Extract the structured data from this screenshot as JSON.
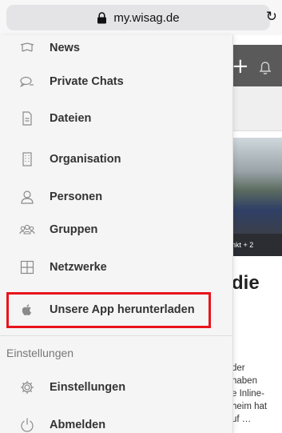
{
  "browser": {
    "url": "my.wisag.de",
    "lock_icon": "lock-icon",
    "reload_icon": "reload-icon"
  },
  "menu": {
    "items": [
      {
        "label": "News",
        "icon": "news-icon"
      },
      {
        "label": "Private Chats",
        "icon": "chat-bubbles-icon"
      },
      {
        "label": "Dateien",
        "icon": "file-icon"
      },
      {
        "label": "Organisation",
        "icon": "building-icon"
      },
      {
        "label": "Personen",
        "icon": "person-icon"
      },
      {
        "label": "Gruppen",
        "icon": "group-icon"
      },
      {
        "label": "Netzwerke",
        "icon": "grid-icon"
      },
      {
        "label": "Unsere App herunterladen",
        "icon": "apple-icon"
      }
    ],
    "section_title": "Einstellungen",
    "settings_items": [
      {
        "label": "Einstellungen",
        "icon": "gear-icon"
      },
      {
        "label": "Abmelden",
        "icon": "power-icon"
      }
    ]
  },
  "background_page": {
    "plus_icon": "+",
    "photo_caption": "ttelpunkt + 2",
    "headline": "die",
    "text_lines": [
      "der",
      "haben",
      "e Inline-",
      "heim hat",
      "uf …"
    ]
  },
  "colors": {
    "highlight": "#e8141b",
    "drawer_bg": "#f5f5f5",
    "header_bg": "#5a5a5a"
  }
}
